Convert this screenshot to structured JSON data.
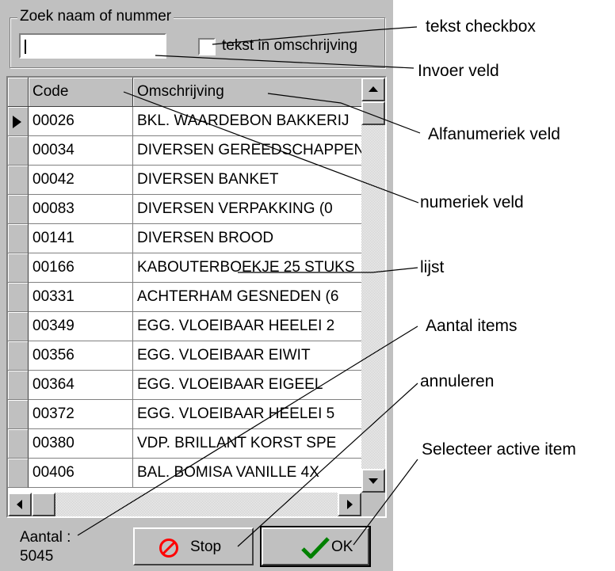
{
  "search": {
    "group_title": "Zoek naam of nummer",
    "input_value": "",
    "checkbox_label": "tekst in omschrijving",
    "checkbox_checked": false
  },
  "grid": {
    "columns": [
      "Code",
      "Omschrijving"
    ],
    "rows": [
      {
        "code": "00026",
        "desc": "BKL. WAARDEBON BAKKERIJ"
      },
      {
        "code": "00034",
        "desc": "DIVERSEN GEREEDSCHAPPEN"
      },
      {
        "code": "00042",
        "desc": "DIVERSEN BANKET"
      },
      {
        "code": "00083",
        "desc": "DIVERSEN VERPAKKING (0"
      },
      {
        "code": "00141",
        "desc": "DIVERSEN BROOD"
      },
      {
        "code": "00166",
        "desc": "KABOUTERBOEKJE 25 STUKS"
      },
      {
        "code": "00331",
        "desc": "ACHTERHAM GESNEDEN (6"
      },
      {
        "code": "00349",
        "desc": "EGG. VLOEIBAAR HEELEI 2"
      },
      {
        "code": "00356",
        "desc": "EGG. VLOEIBAAR EIWIT"
      },
      {
        "code": "00364",
        "desc": "EGG. VLOEIBAAR EIGEEL"
      },
      {
        "code": "00372",
        "desc": "EGG. VLOEIBAAR HEELEI 5"
      },
      {
        "code": "00380",
        "desc": "VDP. BRILLANT KORST SPE"
      },
      {
        "code": "00406",
        "desc": "BAL. BOMISA VANILLE   4X"
      }
    ],
    "active_row": 0
  },
  "footer": {
    "count_label": "Aantal :",
    "count_value": "5045",
    "stop_label": "Stop",
    "ok_label": "OK"
  },
  "annotations": {
    "checkbox": "tekst checkbox",
    "input": "Invoer veld",
    "alfa": "Alfanumeriek veld",
    "numeric": "numeriek veld",
    "list": "lijst",
    "count": "Aantal items",
    "cancel": "annuleren",
    "select": "Selecteer active item"
  },
  "colors": {
    "face": "#c0c0c0",
    "stop_red": "#ff0000",
    "ok_green": "#008000"
  },
  "icons": {
    "stop": "no-entry-icon",
    "ok": "checkmark-icon"
  }
}
